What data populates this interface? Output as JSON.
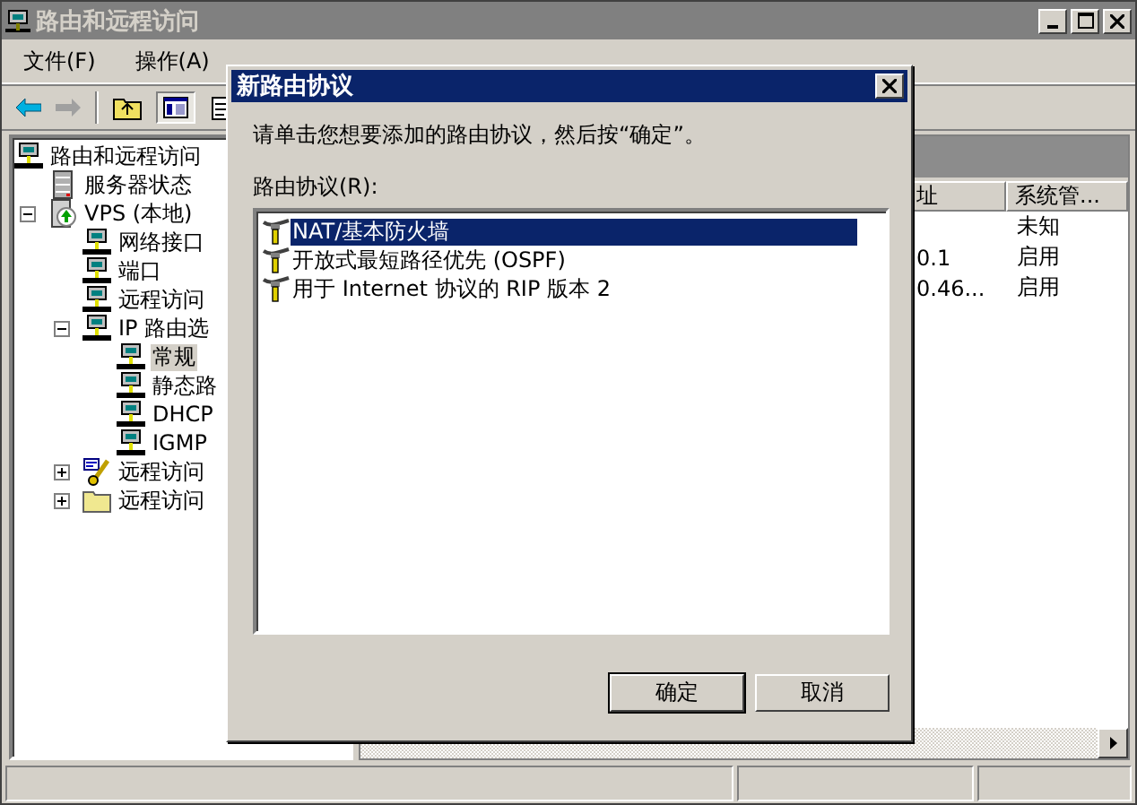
{
  "window": {
    "title": "路由和远程访问"
  },
  "menu": [
    "文件(F)",
    "操作(A)"
  ],
  "tree": [
    {
      "label": "路由和远程访问",
      "kind": "computer",
      "selected": false,
      "children": [
        {
          "label": "服务器状态",
          "kind": "server",
          "selected": false
        },
        {
          "label": "VPS (本地)",
          "kind": "vps",
          "selected": false,
          "expanded": true,
          "children": [
            {
              "label": "网络接口",
              "kind": "computer",
              "selected": false
            },
            {
              "label": "端口",
              "kind": "computer",
              "selected": false
            },
            {
              "label": "远程访问",
              "kind": "computer",
              "selected": false
            },
            {
              "label": "IP 路由选",
              "kind": "computer",
              "selected": false,
              "expanded": true,
              "children": [
                {
                  "label": "常规",
                  "kind": "computer",
                  "selected": true
                },
                {
                  "label": "静态路",
                  "kind": "computer",
                  "selected": false
                },
                {
                  "label": "DHCP",
                  "kind": "computer",
                  "selected": false
                },
                {
                  "label": "IGMP",
                  "kind": "computer",
                  "selected": false
                }
              ]
            },
            {
              "label": "远程访问",
              "kind": "policy",
              "selected": false,
              "expanded": false
            },
            {
              "label": "远程访问",
              "kind": "folder",
              "selected": false,
              "expanded": false
            }
          ]
        }
      ]
    }
  ],
  "list": {
    "columns": [
      "址",
      "系统管..."
    ],
    "rows": [
      {
        "column_2": "未知"
      },
      {
        "column_1": "0.1",
        "column_2": "启用"
      },
      {
        "column_1": "0.46...",
        "column_2": "启用"
      }
    ]
  },
  "dialog": {
    "title": "新路由协议",
    "prompt": "请单击您想要添加的路由协议，然后按“确定”。",
    "list_label": "路由协议(R):",
    "protocols": [
      {
        "label": "NAT/基本防火墙",
        "selected": true
      },
      {
        "label": "开放式最短路径优先 (OSPF)",
        "selected": false
      },
      {
        "label": "用于 Internet 协议的 RIP 版本 2",
        "selected": false
      }
    ],
    "buttons": [
      {
        "label": "确定",
        "default": true
      },
      {
        "label": "取消",
        "default": false
      }
    ]
  }
}
